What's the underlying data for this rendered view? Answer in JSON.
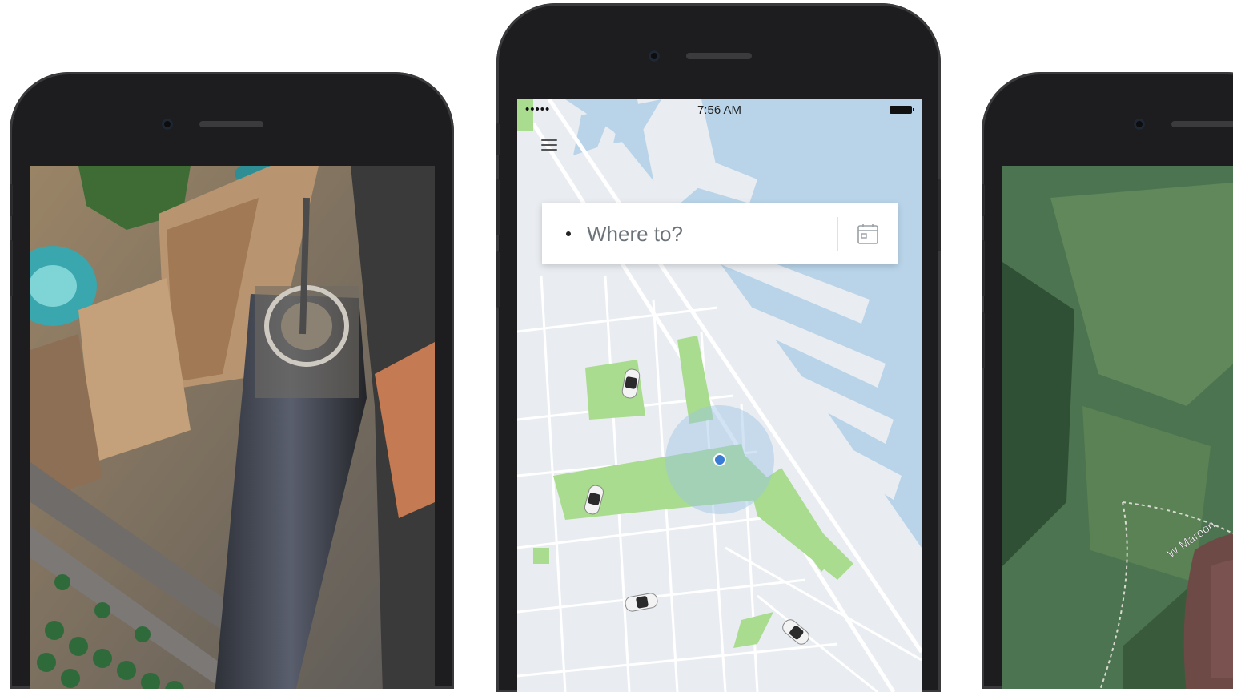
{
  "center_phone": {
    "status_bar": {
      "signal": "•••••",
      "time": "7:56 AM"
    },
    "search": {
      "placeholder": "Where to?"
    },
    "icons": {
      "menu": "hamburger-menu-icon",
      "schedule": "calendar-icon",
      "location": "location-dot-icon",
      "car": "car-icon"
    }
  },
  "right_phone": {
    "map_label": "W Maroon"
  },
  "colors": {
    "water": "#b9d4e9",
    "land": "#e9edf1",
    "park": "#a9dc8e",
    "location": "#3a7bd5",
    "device": "#1d1d1f"
  }
}
